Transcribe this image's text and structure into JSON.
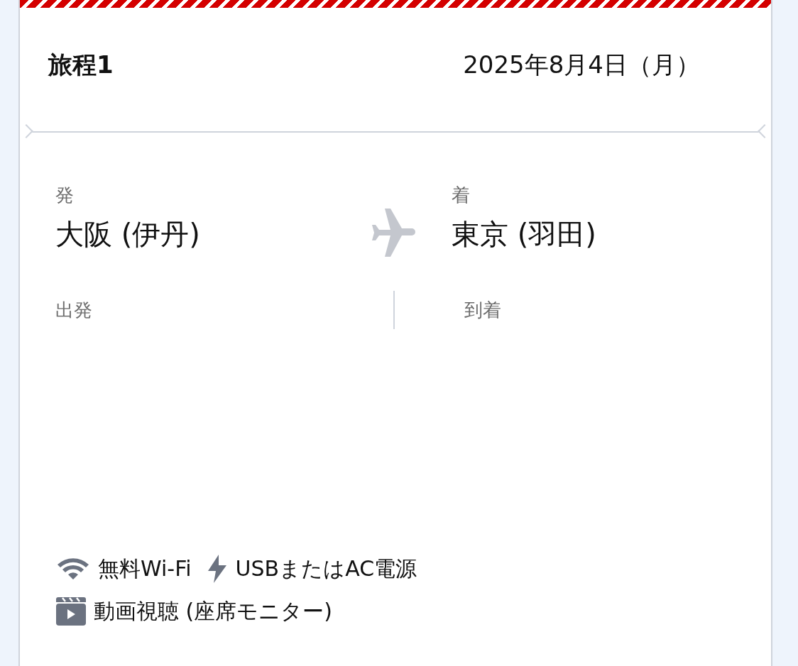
{
  "itinerary": {
    "title": "旅程1",
    "date": "2025年8月4日（月）"
  },
  "route": {
    "departure_label": "発",
    "departure_city": "大阪 (伊丹)",
    "arrival_label": "着",
    "arrival_city": "東京 (羽田)",
    "departure_time_label": "出発",
    "arrival_time_label": "到着"
  },
  "amenities": [
    {
      "kind": "wifi",
      "label": "無料Wi-Fi"
    },
    {
      "kind": "power",
      "label": "USBまたはAC電源"
    },
    {
      "kind": "video",
      "label": "動画視聴 (座席モニター)"
    }
  ]
}
